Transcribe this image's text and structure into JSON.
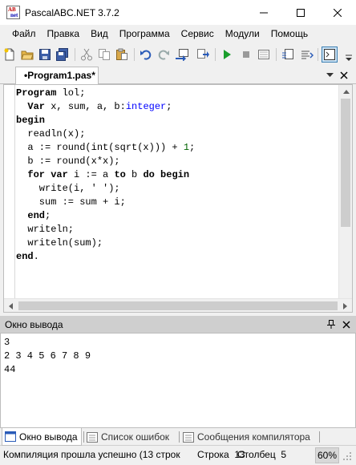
{
  "window": {
    "title": "PascalABC.NET 3.7.2",
    "app_icon_text": [
      "AB",
      "net"
    ]
  },
  "menu": [
    "Файл",
    "Правка",
    "Вид",
    "Программа",
    "Сервис",
    "Модули",
    "Помощь"
  ],
  "toolbar_icons": [
    "new-file-icon",
    "open-folder-icon",
    "save-icon",
    "save-all-icon",
    "cut-icon",
    "copy-icon",
    "paste-icon",
    "undo-icon",
    "redo-icon",
    "compile-icon",
    "step-icon",
    "run-icon",
    "stop-icon",
    "debug-icon",
    "format-icon",
    "output-window-icon",
    "overflow-icon"
  ],
  "editor": {
    "tab_label": "•Program1.pas*",
    "code_lines": [
      [
        {
          "t": "Program ",
          "c": "kw"
        },
        {
          "t": "lol;",
          "c": ""
        }
      ],
      [
        {
          "t": "  Var ",
          "c": "kw"
        },
        {
          "t": "x, sum, a, b:",
          "c": ""
        },
        {
          "t": "integer",
          "c": "ty"
        },
        {
          "t": ";",
          "c": ""
        }
      ],
      [
        {
          "t": "begin",
          "c": "kw"
        }
      ],
      [
        {
          "t": "  readln(x);",
          "c": ""
        }
      ],
      [
        {
          "t": "  a := round(int(sqrt(x))) + ",
          "c": ""
        },
        {
          "t": "1",
          "c": "nu"
        },
        {
          "t": ";",
          "c": ""
        }
      ],
      [
        {
          "t": "  b := round(x*x);",
          "c": ""
        }
      ],
      [
        {
          "t": "  for var ",
          "c": "kw"
        },
        {
          "t": "i := a ",
          "c": ""
        },
        {
          "t": "to ",
          "c": "kw"
        },
        {
          "t": "b ",
          "c": ""
        },
        {
          "t": "do begin",
          "c": "kw"
        }
      ],
      [
        {
          "t": "    write(i, ' ');",
          "c": ""
        }
      ],
      [
        {
          "t": "    sum := sum + i;",
          "c": ""
        }
      ],
      [
        {
          "t": "  end",
          "c": "kw"
        },
        {
          "t": ";",
          "c": ""
        }
      ],
      [
        {
          "t": "  writeln;",
          "c": ""
        }
      ],
      [
        {
          "t": "  writeln(sum);",
          "c": ""
        }
      ],
      [
        {
          "t": "end",
          "c": "kw"
        },
        {
          "t": ".",
          "c": ""
        }
      ]
    ]
  },
  "output": {
    "title": "Окно вывода",
    "lines": [
      "3",
      "2 3 4 5 6 7 8 9",
      "44"
    ]
  },
  "bottom_tabs": [
    {
      "label": "Окно вывода",
      "active": true
    },
    {
      "label": "Список ошибок",
      "active": false
    },
    {
      "label": "Сообщения компилятора",
      "active": false
    }
  ],
  "status": {
    "message": "Компиляция прошла успешно (13 строк",
    "line_label": "Строка",
    "line_value": "13",
    "col_label": "Столбец",
    "col_value": "5",
    "zoom": "60%"
  },
  "colors": {
    "keyword": "#000000",
    "type": "#0000ff",
    "number": "#006400",
    "panel_header": "#cfcfcf",
    "run_green": "#1a9e2c"
  }
}
